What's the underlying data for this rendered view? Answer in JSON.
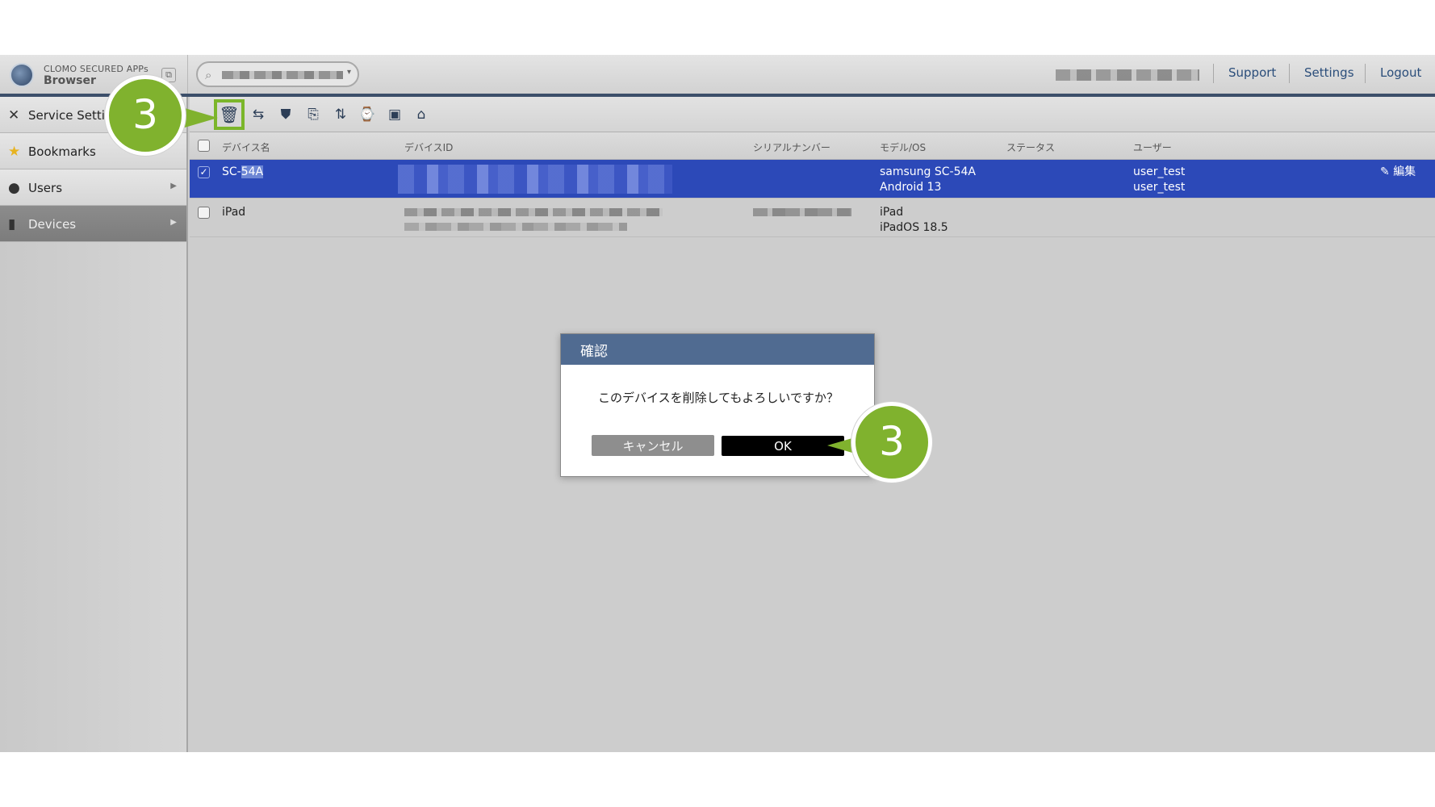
{
  "brand": {
    "line1": "CLOMO SECURED APPs",
    "line2": "Browser"
  },
  "header": {
    "links": [
      "Support",
      "Settings",
      "Logout"
    ]
  },
  "sidebar": {
    "items": [
      {
        "label": "Service Settin",
        "icon": "tools-icon"
      },
      {
        "label": "Bookmarks",
        "icon": "star-icon"
      },
      {
        "label": "Users",
        "icon": "user-icon"
      },
      {
        "label": "Devices",
        "icon": "device-icon",
        "active": true
      }
    ]
  },
  "table": {
    "columns": [
      "デバイス名",
      "デバイスID",
      "シリアルナンバー",
      "モデル/OS",
      "ステータス",
      "ユーザー"
    ],
    "rows": [
      {
        "selected": true,
        "name_prefix": "SC-",
        "name_highlight": "54A",
        "model": "samsung SC-54A",
        "os": "Android 13",
        "user1": "user_test",
        "user2": "user_test",
        "edit": "編集"
      },
      {
        "selected": false,
        "name": "iPad",
        "model": "iPad",
        "os": "iPadOS 18.5"
      }
    ]
  },
  "dialog": {
    "title": "確認",
    "message": "このデバイスを削除してもよろしいですか？",
    "cancel": "キャンセル",
    "ok": "OK"
  },
  "callouts": {
    "toolbar": "3",
    "dialog": "3"
  },
  "colors": {
    "accent_green": "#80b22e",
    "selection_blue": "#2c49b8",
    "dialog_header": "#506b91"
  }
}
